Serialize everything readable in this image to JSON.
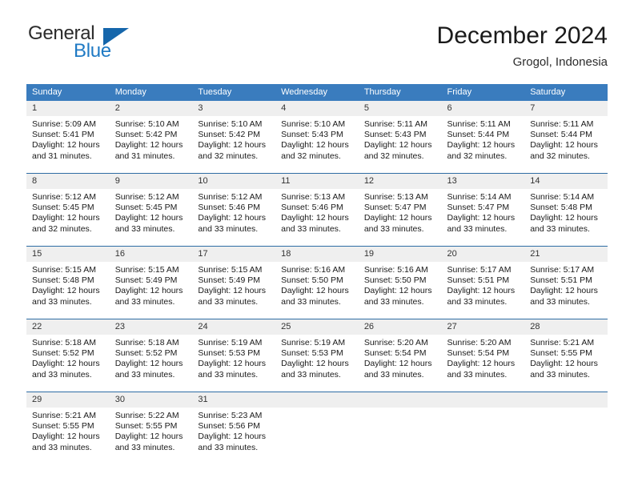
{
  "brand": {
    "name_part1": "General",
    "name_part2": "Blue",
    "logo_icon": "triangle-flag-icon",
    "accent_color": "#1f7ac4",
    "triangle_color": "#1566ab"
  },
  "header": {
    "title": "December 2024",
    "location": "Grogol, Indonesia"
  },
  "calendar": {
    "header_bg_color": "#3a7cbe",
    "daynum_bg_color": "#efefef",
    "row_divider_color": "#2e6da4",
    "weekdays": [
      "Sunday",
      "Monday",
      "Tuesday",
      "Wednesday",
      "Thursday",
      "Friday",
      "Saturday"
    ],
    "weeks": [
      [
        {
          "day": "1",
          "sunrise": "Sunrise: 5:09 AM",
          "sunset": "Sunset: 5:41 PM",
          "daylight_line1": "Daylight: 12 hours",
          "daylight_line2": "and 31 minutes."
        },
        {
          "day": "2",
          "sunrise": "Sunrise: 5:10 AM",
          "sunset": "Sunset: 5:42 PM",
          "daylight_line1": "Daylight: 12 hours",
          "daylight_line2": "and 31 minutes."
        },
        {
          "day": "3",
          "sunrise": "Sunrise: 5:10 AM",
          "sunset": "Sunset: 5:42 PM",
          "daylight_line1": "Daylight: 12 hours",
          "daylight_line2": "and 32 minutes."
        },
        {
          "day": "4",
          "sunrise": "Sunrise: 5:10 AM",
          "sunset": "Sunset: 5:43 PM",
          "daylight_line1": "Daylight: 12 hours",
          "daylight_line2": "and 32 minutes."
        },
        {
          "day": "5",
          "sunrise": "Sunrise: 5:11 AM",
          "sunset": "Sunset: 5:43 PM",
          "daylight_line1": "Daylight: 12 hours",
          "daylight_line2": "and 32 minutes."
        },
        {
          "day": "6",
          "sunrise": "Sunrise: 5:11 AM",
          "sunset": "Sunset: 5:44 PM",
          "daylight_line1": "Daylight: 12 hours",
          "daylight_line2": "and 32 minutes."
        },
        {
          "day": "7",
          "sunrise": "Sunrise: 5:11 AM",
          "sunset": "Sunset: 5:44 PM",
          "daylight_line1": "Daylight: 12 hours",
          "daylight_line2": "and 32 minutes."
        }
      ],
      [
        {
          "day": "8",
          "sunrise": "Sunrise: 5:12 AM",
          "sunset": "Sunset: 5:45 PM",
          "daylight_line1": "Daylight: 12 hours",
          "daylight_line2": "and 32 minutes."
        },
        {
          "day": "9",
          "sunrise": "Sunrise: 5:12 AM",
          "sunset": "Sunset: 5:45 PM",
          "daylight_line1": "Daylight: 12 hours",
          "daylight_line2": "and 33 minutes."
        },
        {
          "day": "10",
          "sunrise": "Sunrise: 5:12 AM",
          "sunset": "Sunset: 5:46 PM",
          "daylight_line1": "Daylight: 12 hours",
          "daylight_line2": "and 33 minutes."
        },
        {
          "day": "11",
          "sunrise": "Sunrise: 5:13 AM",
          "sunset": "Sunset: 5:46 PM",
          "daylight_line1": "Daylight: 12 hours",
          "daylight_line2": "and 33 minutes."
        },
        {
          "day": "12",
          "sunrise": "Sunrise: 5:13 AM",
          "sunset": "Sunset: 5:47 PM",
          "daylight_line1": "Daylight: 12 hours",
          "daylight_line2": "and 33 minutes."
        },
        {
          "day": "13",
          "sunrise": "Sunrise: 5:14 AM",
          "sunset": "Sunset: 5:47 PM",
          "daylight_line1": "Daylight: 12 hours",
          "daylight_line2": "and 33 minutes."
        },
        {
          "day": "14",
          "sunrise": "Sunrise: 5:14 AM",
          "sunset": "Sunset: 5:48 PM",
          "daylight_line1": "Daylight: 12 hours",
          "daylight_line2": "and 33 minutes."
        }
      ],
      [
        {
          "day": "15",
          "sunrise": "Sunrise: 5:15 AM",
          "sunset": "Sunset: 5:48 PM",
          "daylight_line1": "Daylight: 12 hours",
          "daylight_line2": "and 33 minutes."
        },
        {
          "day": "16",
          "sunrise": "Sunrise: 5:15 AM",
          "sunset": "Sunset: 5:49 PM",
          "daylight_line1": "Daylight: 12 hours",
          "daylight_line2": "and 33 minutes."
        },
        {
          "day": "17",
          "sunrise": "Sunrise: 5:15 AM",
          "sunset": "Sunset: 5:49 PM",
          "daylight_line1": "Daylight: 12 hours",
          "daylight_line2": "and 33 minutes."
        },
        {
          "day": "18",
          "sunrise": "Sunrise: 5:16 AM",
          "sunset": "Sunset: 5:50 PM",
          "daylight_line1": "Daylight: 12 hours",
          "daylight_line2": "and 33 minutes."
        },
        {
          "day": "19",
          "sunrise": "Sunrise: 5:16 AM",
          "sunset": "Sunset: 5:50 PM",
          "daylight_line1": "Daylight: 12 hours",
          "daylight_line2": "and 33 minutes."
        },
        {
          "day": "20",
          "sunrise": "Sunrise: 5:17 AM",
          "sunset": "Sunset: 5:51 PM",
          "daylight_line1": "Daylight: 12 hours",
          "daylight_line2": "and 33 minutes."
        },
        {
          "day": "21",
          "sunrise": "Sunrise: 5:17 AM",
          "sunset": "Sunset: 5:51 PM",
          "daylight_line1": "Daylight: 12 hours",
          "daylight_line2": "and 33 minutes."
        }
      ],
      [
        {
          "day": "22",
          "sunrise": "Sunrise: 5:18 AM",
          "sunset": "Sunset: 5:52 PM",
          "daylight_line1": "Daylight: 12 hours",
          "daylight_line2": "and 33 minutes."
        },
        {
          "day": "23",
          "sunrise": "Sunrise: 5:18 AM",
          "sunset": "Sunset: 5:52 PM",
          "daylight_line1": "Daylight: 12 hours",
          "daylight_line2": "and 33 minutes."
        },
        {
          "day": "24",
          "sunrise": "Sunrise: 5:19 AM",
          "sunset": "Sunset: 5:53 PM",
          "daylight_line1": "Daylight: 12 hours",
          "daylight_line2": "and 33 minutes."
        },
        {
          "day": "25",
          "sunrise": "Sunrise: 5:19 AM",
          "sunset": "Sunset: 5:53 PM",
          "daylight_line1": "Daylight: 12 hours",
          "daylight_line2": "and 33 minutes."
        },
        {
          "day": "26",
          "sunrise": "Sunrise: 5:20 AM",
          "sunset": "Sunset: 5:54 PM",
          "daylight_line1": "Daylight: 12 hours",
          "daylight_line2": "and 33 minutes."
        },
        {
          "day": "27",
          "sunrise": "Sunrise: 5:20 AM",
          "sunset": "Sunset: 5:54 PM",
          "daylight_line1": "Daylight: 12 hours",
          "daylight_line2": "and 33 minutes."
        },
        {
          "day": "28",
          "sunrise": "Sunrise: 5:21 AM",
          "sunset": "Sunset: 5:55 PM",
          "daylight_line1": "Daylight: 12 hours",
          "daylight_line2": "and 33 minutes."
        }
      ],
      [
        {
          "day": "29",
          "sunrise": "Sunrise: 5:21 AM",
          "sunset": "Sunset: 5:55 PM",
          "daylight_line1": "Daylight: 12 hours",
          "daylight_line2": "and 33 minutes."
        },
        {
          "day": "30",
          "sunrise": "Sunrise: 5:22 AM",
          "sunset": "Sunset: 5:55 PM",
          "daylight_line1": "Daylight: 12 hours",
          "daylight_line2": "and 33 minutes."
        },
        {
          "day": "31",
          "sunrise": "Sunrise: 5:23 AM",
          "sunset": "Sunset: 5:56 PM",
          "daylight_line1": "Daylight: 12 hours",
          "daylight_line2": "and 33 minutes."
        },
        {
          "day": "",
          "sunrise": "",
          "sunset": "",
          "daylight_line1": "",
          "daylight_line2": ""
        },
        {
          "day": "",
          "sunrise": "",
          "sunset": "",
          "daylight_line1": "",
          "daylight_line2": ""
        },
        {
          "day": "",
          "sunrise": "",
          "sunset": "",
          "daylight_line1": "",
          "daylight_line2": ""
        },
        {
          "day": "",
          "sunrise": "",
          "sunset": "",
          "daylight_line1": "",
          "daylight_line2": ""
        }
      ]
    ]
  }
}
